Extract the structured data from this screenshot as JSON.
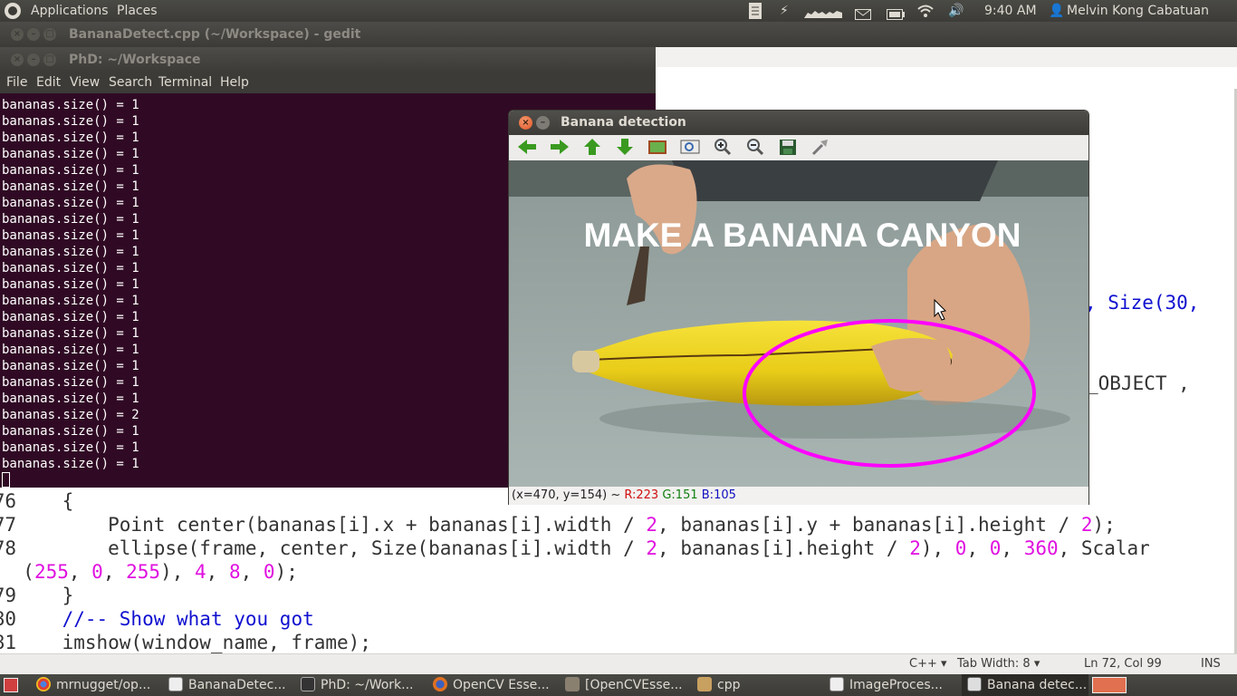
{
  "top_panel": {
    "applications": "Applications",
    "places": "Places",
    "clock": "9:40 AM",
    "user": "Melvin Kong Cabatuan",
    "icons": [
      "document-icon",
      "flash-icon",
      "network-graph-icon",
      "mail-icon",
      "battery-icon",
      "wifi-icon",
      "volume-icon"
    ]
  },
  "gedit": {
    "title": "BananaDetect.cpp (~/Workspace) - gedit",
    "status": {
      "language": "C++",
      "tab_width": "Tab Width: 8",
      "position": "Ln 72, Col 99",
      "mode": "INS"
    },
    "right_fragments": [
      ", Size(30,",
      "_OBJECT ,"
    ]
  },
  "terminal": {
    "title": "PhD: ~/Workspace",
    "menu": [
      "File",
      "Edit",
      "View",
      "Search",
      "Terminal",
      "Help"
    ],
    "lines": [
      "bananas.size() = 1",
      "bananas.size() = 1",
      "bananas.size() = 1",
      "bananas.size() = 1",
      "bananas.size() = 1",
      "bananas.size() = 1",
      "bananas.size() = 1",
      "bananas.size() = 1",
      "bananas.size() = 1",
      "bananas.size() = 1",
      "bananas.size() = 1",
      "bananas.size() = 1",
      "bananas.size() = 1",
      "bananas.size() = 1",
      "bananas.size() = 1",
      "bananas.size() = 1",
      "bananas.size() = 1",
      "bananas.size() = 1",
      "bananas.size() = 1",
      "bananas.size() = 2",
      "bananas.size() = 1",
      "bananas.size() = 1",
      "bananas.size() = 1"
    ]
  },
  "banana_window": {
    "title": "Banana detection",
    "toolbar": [
      "arrow-left-icon",
      "arrow-right-icon",
      "arrow-up-icon",
      "arrow-down-icon",
      "image-icon",
      "zoom-fit-icon",
      "zoom-in-icon",
      "zoom-out-icon",
      "save-icon",
      "properties-icon"
    ],
    "overlay_text": "MAKE A BANANA CANYON",
    "status": {
      "coords": "(x=470, y=154) ~",
      "r": "R:223",
      "g": "G:151",
      "b": "B:105"
    },
    "colors": {
      "ellipse": "#ff00ff",
      "banana": "#f0d020",
      "background": "#9aaaa6"
    }
  },
  "taskbar": {
    "items": [
      "mrnugget/op...",
      "BananaDetec...",
      "PhD: ~/Work...",
      "OpenCV Esse...",
      "[OpenCVEsse...",
      "cpp",
      "ImageProces...",
      "Banana detec..."
    ]
  }
}
